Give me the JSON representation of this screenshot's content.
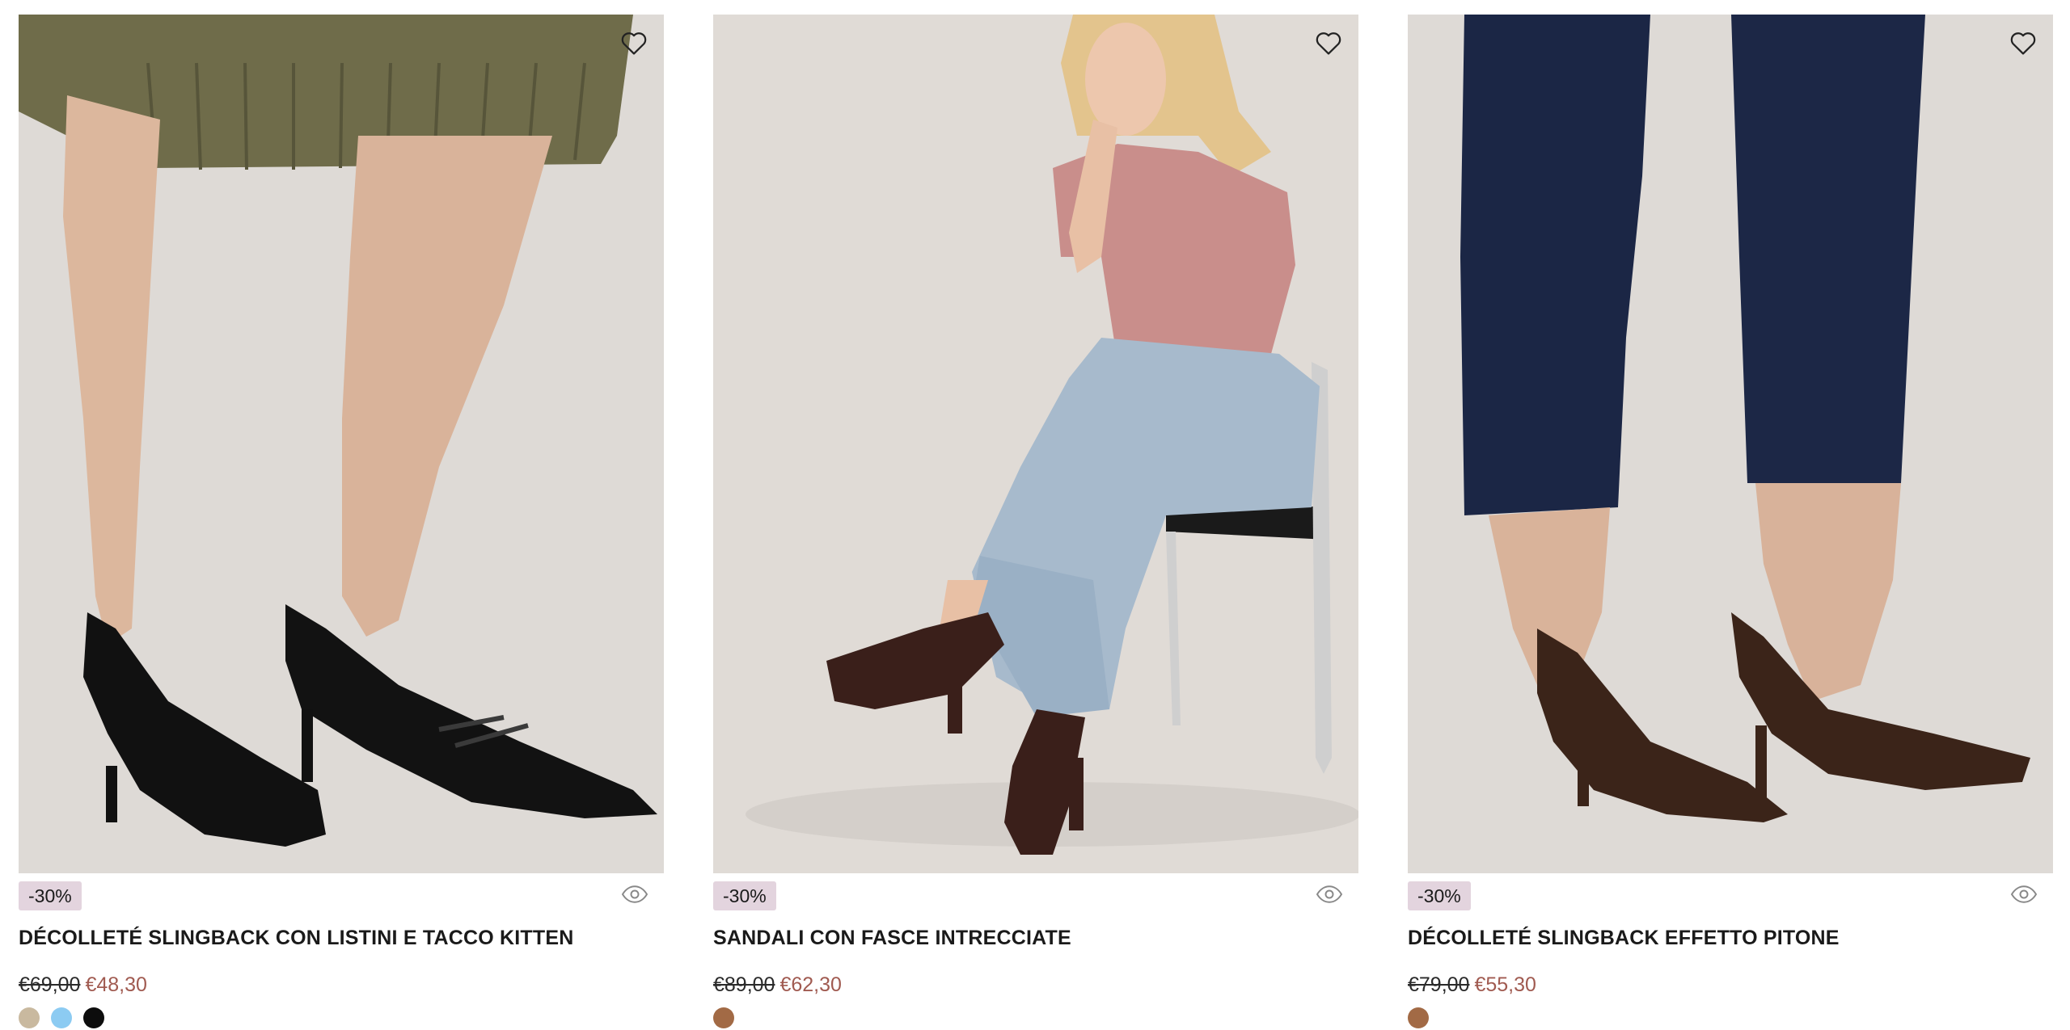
{
  "products": [
    {
      "discount": "-30%",
      "title": "DÉCOLLETÉ SLINGBACK CON LISTINI E TACCO KITTEN",
      "price_old": "€69,00",
      "price_new": "€48,30",
      "swatches": [
        "#c9b99f",
        "#8ccbf2",
        "#0d0d0d"
      ]
    },
    {
      "discount": "-30%",
      "title": "SANDALI CON FASCE INTRECCIATE",
      "price_old": "€89,00",
      "price_new": "€62,30",
      "swatches": [
        "#a26a45"
      ]
    },
    {
      "discount": "-30%",
      "title": "DÉCOLLETÉ SLINGBACK EFFETTO PITONE",
      "price_old": "€79,00",
      "price_new": "€55,30",
      "swatches": [
        "#a26a45"
      ]
    }
  ],
  "icons": {
    "wishlist": "heart-outline-icon",
    "quick_view": "eye-icon"
  },
  "colors": {
    "badge_bg": "#e3d4de",
    "sale_price": "#a05a50",
    "photo_bg": "#e1dcd7"
  }
}
